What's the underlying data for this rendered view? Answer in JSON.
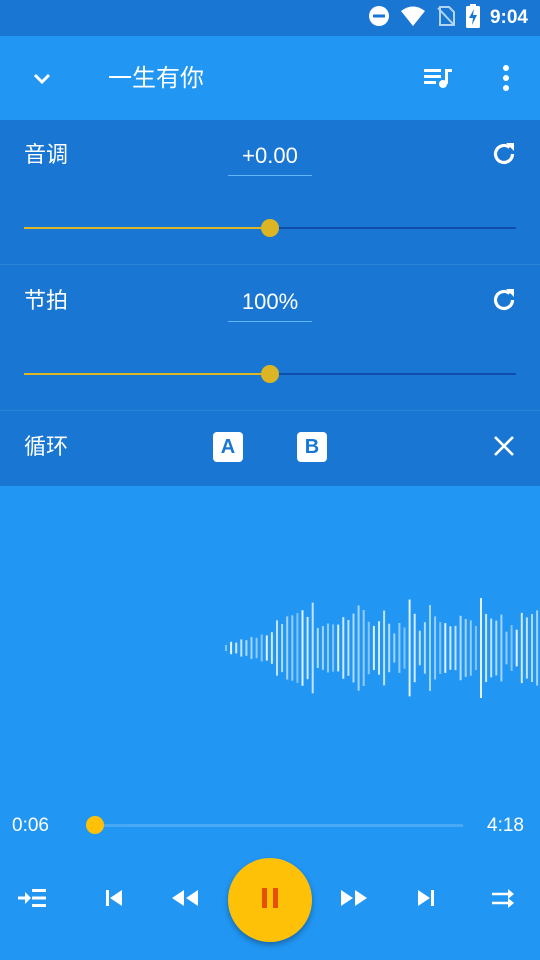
{
  "status_bar": {
    "time": "9:04",
    "icons": [
      "do-not-disturb-icon",
      "wifi-icon",
      "no-sim-icon",
      "battery-charging-icon"
    ]
  },
  "toolbar": {
    "collapse_icon": "chevron-down-icon",
    "title": "一生有你",
    "playlist_icon": "playlist-music-icon",
    "more_icon": "more-vertical-icon"
  },
  "pitch": {
    "label": "音调",
    "value": "+0.00",
    "slider_fraction": 0.5,
    "reset_icon": "refresh-icon"
  },
  "tempo": {
    "label": "节拍",
    "value": "100%",
    "slider_fraction": 0.5,
    "reset_icon": "refresh-icon"
  },
  "loop": {
    "label": "循环",
    "a_label": "A",
    "b_label": "B",
    "close_icon": "close-icon"
  },
  "playback": {
    "current_time": "0:06",
    "total_time": "4:18",
    "progress_fraction": 0.023
  },
  "controls": {
    "queue_icon": "add-to-queue-icon",
    "prev_icon": "skip-previous-icon",
    "rewind_icon": "rewind-icon",
    "play_pause_icon": "pause-icon",
    "forward_icon": "fast-forward-icon",
    "next_icon": "skip-next-icon",
    "repeat_icon": "repeat-icon"
  },
  "colors": {
    "primary": "#2196F3",
    "primary_dark": "#1976D2",
    "accent": "#FFC107"
  }
}
